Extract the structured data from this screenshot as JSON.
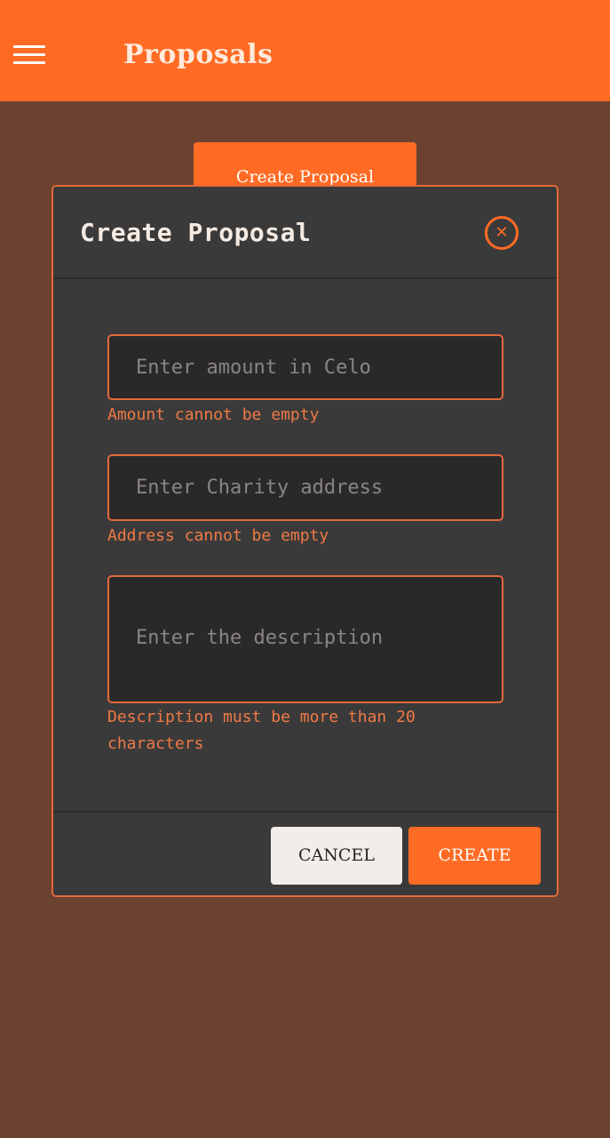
{
  "appbar": {
    "title": "Proposals",
    "menu_icon": "hamburger-menu-icon"
  },
  "background": {
    "create_proposal_label": "Create Proposal"
  },
  "modal": {
    "title": "Create Proposal",
    "close_icon": "close-circle-icon",
    "amount": {
      "value": "",
      "placeholder": "Enter amount in Celo",
      "error": "Amount cannot be empty"
    },
    "address": {
      "value": "",
      "placeholder": "Enter Charity address",
      "error": "Address cannot be empty"
    },
    "description": {
      "value": "",
      "placeholder": "Enter the description",
      "error": "Description must be more than 20 characters"
    },
    "cancel_label": "CANCEL",
    "create_label": "CREATE"
  },
  "colors": {
    "accent": "#ff6b24",
    "page_background": "#6b4230",
    "modal_background": "#3b3a3a",
    "input_background": "#2a2929",
    "error_text": "#ee7a45"
  }
}
